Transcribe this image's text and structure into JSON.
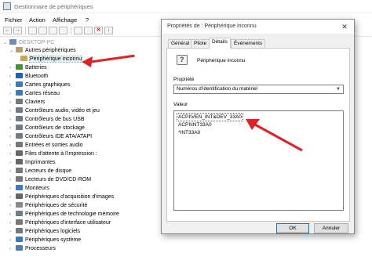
{
  "window": {
    "title": "Gestionnaire de périphériques"
  },
  "menu": [
    "Fichier",
    "Action",
    "Affichage",
    "?"
  ],
  "toolbar": {
    "back": "←",
    "forward": "→",
    "remove": "✕",
    "update": "↓"
  },
  "tree": {
    "root": "DESKTOP-PC",
    "items": [
      {
        "label": "Autres périphériques",
        "expanded": true,
        "color": "#b5a06e"
      },
      {
        "label": "Périphérique inconnu",
        "child": true,
        "selected": true,
        "color": "#c8a850"
      },
      {
        "label": "Batteries",
        "color": "#4a8f3a"
      },
      {
        "label": "Bluetooth",
        "color": "#1f5fbf"
      },
      {
        "label": "Cartes graphiques",
        "color": "#3e7ab8"
      },
      {
        "label": "Cartes réseau",
        "color": "#3e7ab8"
      },
      {
        "label": "Claviers",
        "color": "#777777"
      },
      {
        "label": "Contrôleurs audio, vidéo et jeu",
        "color": "#6f7b86"
      },
      {
        "label": "Contrôleurs de bus USB",
        "color": "#6f7b86"
      },
      {
        "label": "Contrôleurs de stockage",
        "color": "#6f7b86"
      },
      {
        "label": "Contrôleurs IDE ATA/ATAPI",
        "color": "#6f7b86"
      },
      {
        "label": "Entrées et sorties audio",
        "color": "#777777"
      },
      {
        "label": "Files d'attente à l'impression :",
        "color": "#666666"
      },
      {
        "label": "Imprimantes",
        "color": "#666666"
      },
      {
        "label": "Lecteurs de disque",
        "color": "#777777"
      },
      {
        "label": "Lecteurs de DVD/CD-ROM",
        "color": "#777777"
      },
      {
        "label": "Moniteurs",
        "color": "#3e7ab8"
      },
      {
        "label": "Périphériques d'acquisition d'images",
        "color": "#666666"
      },
      {
        "label": "Périphériques de sécurité",
        "color": "#8a8a8a"
      },
      {
        "label": "Périphériques de technologie mémoire",
        "color": "#6f7b86"
      },
      {
        "label": "Périphériques d'interface utilisateur",
        "color": "#777777"
      },
      {
        "label": "Périphériques logiciels",
        "color": "#777777"
      },
      {
        "label": "Périphériques système",
        "color": "#3e7ab8"
      },
      {
        "label": "Processeurs",
        "color": "#4f7fa8"
      }
    ]
  },
  "dialog": {
    "title": "Propriétés de : Périphérique inconnu",
    "close": "✕",
    "tabs": [
      "Général",
      "Pilote",
      "Détails",
      "Événements"
    ],
    "active_tab": "Détails",
    "device_name": "Périphérique inconnu",
    "property_label": "Propriété",
    "property_value": "Numéros d'identification du matériel",
    "value_label": "Valeur",
    "values": [
      "ACPI\\VEN_INT&DEV_33A0",
      "ACPI\\INT33A0",
      "*INT33A0"
    ],
    "ok": "OK",
    "cancel": "Annuler"
  },
  "colors": {
    "arrow": "#e02127",
    "selection": "#e5f1fb",
    "ok_border": "#0078d7"
  }
}
